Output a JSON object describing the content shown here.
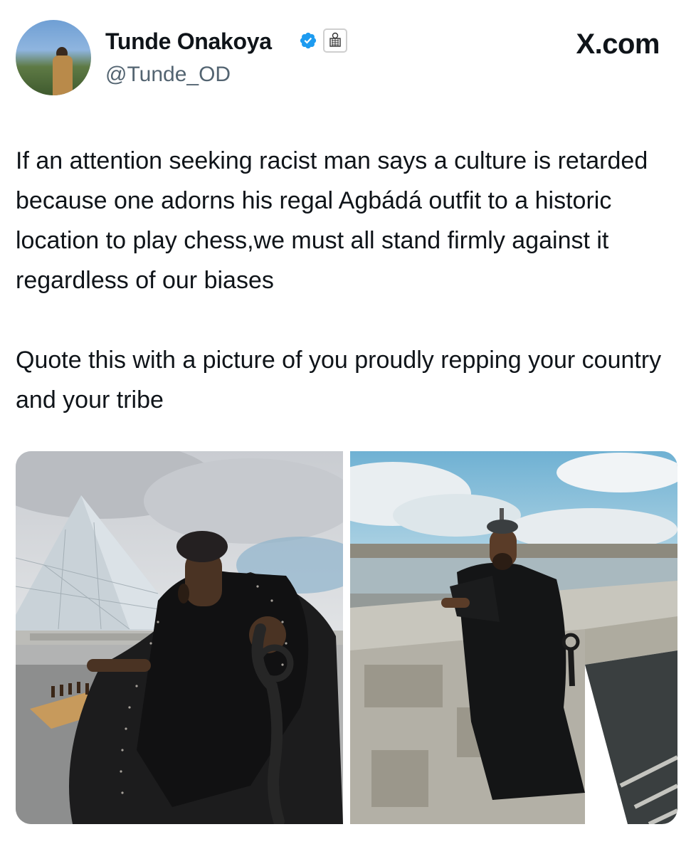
{
  "author": {
    "name": "Tunde Onakoya",
    "handle": "@Tunde_OD",
    "verified": true,
    "avatar_icon": "profile-photo",
    "affiliation_icon": "organization-badge-icon"
  },
  "brand": "X.com",
  "tweet": {
    "paragraphs": [
      "If an attention seeking racist man says a culture is retarded because one adorns his regal Agbádá outfit to a historic location to play chess,we must all stand firmly against it regardless of our biases",
      "Quote this with a picture of you proudly repping your country and your tribe"
    ]
  },
  "media": [
    {
      "icon": "photo-louvre-pyramid-chess"
    },
    {
      "icon": "photo-seine-bridge"
    }
  ],
  "colors": {
    "text": "#0f1419",
    "secondary": "#536471",
    "verified": "#1d9bf0"
  }
}
